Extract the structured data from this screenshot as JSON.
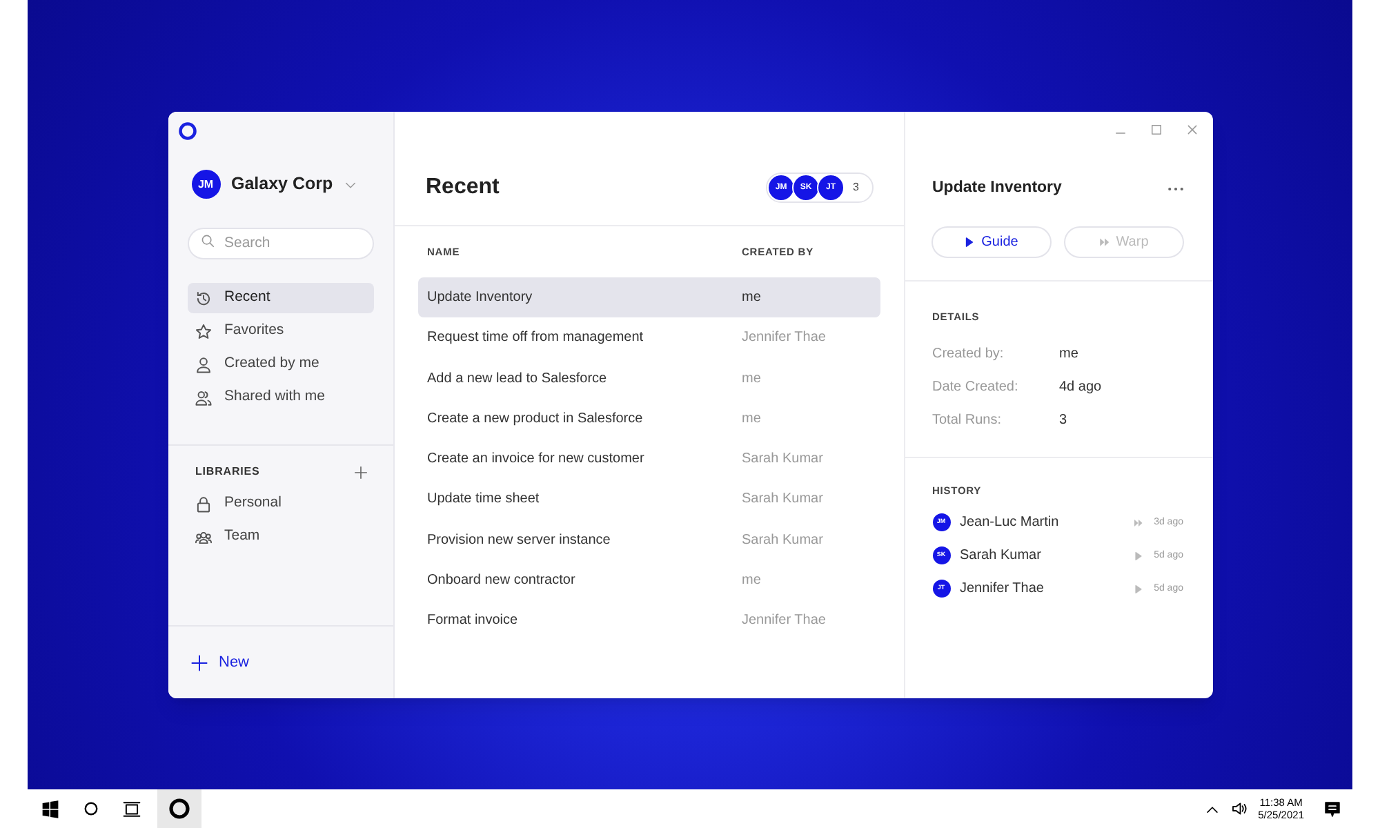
{
  "sidebar": {
    "org": {
      "initials": "JM",
      "name": "Galaxy Corp"
    },
    "search": {
      "placeholder": "Search"
    },
    "items": [
      {
        "label": "Recent",
        "kind": "history",
        "selected": true
      },
      {
        "label": "Favorites",
        "kind": "star",
        "selected": false
      },
      {
        "label": "Created by me",
        "kind": "person",
        "selected": false
      },
      {
        "label": "Shared with me",
        "kind": "people",
        "selected": false
      }
    ],
    "libraries": {
      "title": "LIBRARIES",
      "items": [
        {
          "label": "Personal",
          "kind": "lock",
          "selected": false
        },
        {
          "label": "Team",
          "kind": "group",
          "selected": false
        }
      ]
    },
    "new_button": "New"
  },
  "main": {
    "title": "Recent",
    "members": [
      "JM",
      "SK",
      "JT"
    ],
    "member_count": "3",
    "table": {
      "columns": [
        "NAME",
        "CREATED BY"
      ],
      "rows": [
        {
          "name": "Update Inventory",
          "created_by": "me",
          "selected": true
        },
        {
          "name": "Request time off from management",
          "created_by": "Jennifer Thae",
          "selected": false
        },
        {
          "name": "Add a new lead to Salesforce",
          "created_by": "me",
          "selected": false
        },
        {
          "name": "Create a new product in Salesforce",
          "created_by": "me",
          "selected": false
        },
        {
          "name": "Create an invoice for new customer",
          "created_by": "Sarah Kumar",
          "selected": false
        },
        {
          "name": "Update time sheet",
          "created_by": "Sarah Kumar",
          "selected": false
        },
        {
          "name": "Provision new server instance",
          "created_by": "Sarah Kumar",
          "selected": false
        },
        {
          "name": "Onboard new contractor",
          "created_by": "me",
          "selected": false
        },
        {
          "name": "Format invoice",
          "created_by": "Jennifer Thae",
          "selected": false
        }
      ]
    }
  },
  "details_panel": {
    "title": "Update Inventory",
    "buttons": [
      {
        "label": "Guide",
        "kind": "guide",
        "disabled": false
      },
      {
        "label": "Warp",
        "kind": "warp",
        "disabled": true
      }
    ],
    "details_title": "DETAILS",
    "details": [
      {
        "label": "Created by:",
        "value": "me"
      },
      {
        "label": "Date Created:",
        "value": "4d ago"
      },
      {
        "label": "Total Runs:",
        "value": "3"
      }
    ],
    "history_title": "HISTORY",
    "history": [
      {
        "initials": "JM",
        "name": "Jean-Luc Martin",
        "kind": "warp",
        "time": "3d ago"
      },
      {
        "initials": "SK",
        "name": "Sarah Kumar",
        "kind": "guide",
        "time": "5d ago"
      },
      {
        "initials": "JT",
        "name": "Jennifer Thae",
        "kind": "guide",
        "time": "5d ago"
      }
    ]
  },
  "taskbar": {
    "time": "11:38 AM",
    "date": "5/25/2021"
  }
}
